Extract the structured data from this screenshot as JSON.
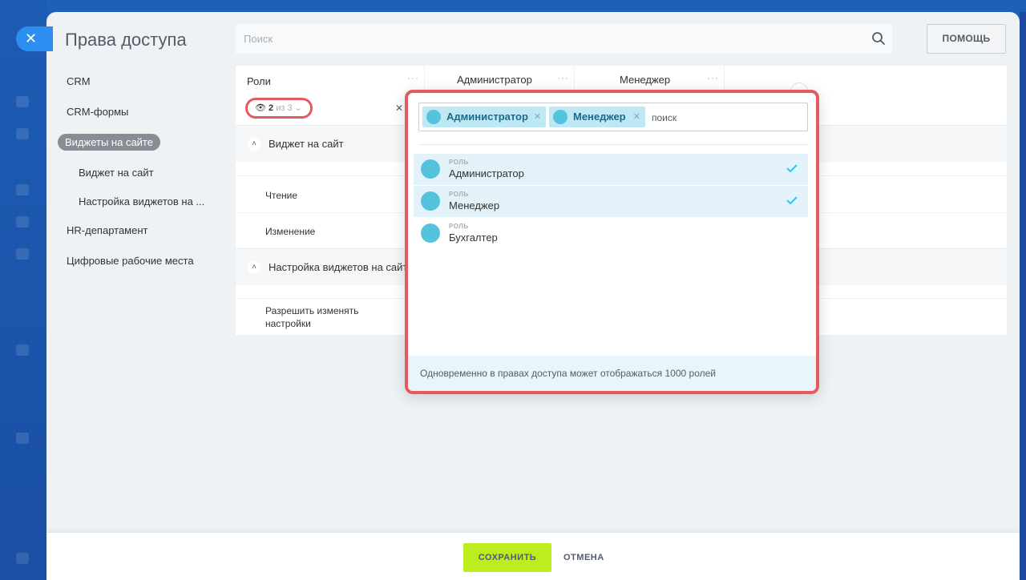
{
  "page": {
    "title": "Права доступа",
    "search_placeholder": "Поиск",
    "help_label": "ПОМОЩЬ"
  },
  "nav": {
    "items": [
      {
        "label": "CRM"
      },
      {
        "label": "CRM-формы"
      },
      {
        "label": "Виджеты на сайте",
        "active": true
      },
      {
        "label": "Виджет на сайт",
        "sub": true
      },
      {
        "label": "Настройка виджетов на ...",
        "sub": true
      },
      {
        "label": "HR-департамент"
      },
      {
        "label": "Цифровые рабочие места"
      }
    ]
  },
  "table": {
    "columns": [
      {
        "label": "Роли"
      },
      {
        "label": "Администратор"
      },
      {
        "label": "Менеджер"
      }
    ],
    "counter": {
      "shown": "2",
      "of_text": "из 3"
    },
    "sections": [
      {
        "label": "Виджет на сайт",
        "rows": [
          {
            "label": "Чтение"
          },
          {
            "label": "Изменение"
          }
        ]
      },
      {
        "label": "Настройка виджетов на сайт",
        "rows": [
          {
            "label": "Разрешить изменять настройки"
          }
        ]
      }
    ]
  },
  "role_selector": {
    "selected_tags": [
      {
        "label": "Администратор"
      },
      {
        "label": "Менеджер"
      }
    ],
    "search_placeholder": "поиск",
    "items": [
      {
        "type": "РОЛЬ",
        "name": "Администратор",
        "selected": true
      },
      {
        "type": "РОЛЬ",
        "name": "Менеджер",
        "selected": true
      },
      {
        "type": "РОЛЬ",
        "name": "Бухгалтер",
        "selected": false
      }
    ],
    "footer_note": "Одновременно в правах доступа может отображаться 1000 ролей"
  },
  "footer": {
    "save_label": "СОХРАНИТЬ",
    "cancel_label": "ОТМЕНА"
  },
  "colors": {
    "accent_highlight": "#e55a5f",
    "save_button": "#bbed21",
    "avatar": "#55c3dd",
    "selected_row": "#e3f3f9"
  },
  "icons": {
    "close": "close-icon",
    "search": "search-icon",
    "eye": "eye-icon",
    "check": "check-icon",
    "group": "group-avatar-icon"
  }
}
